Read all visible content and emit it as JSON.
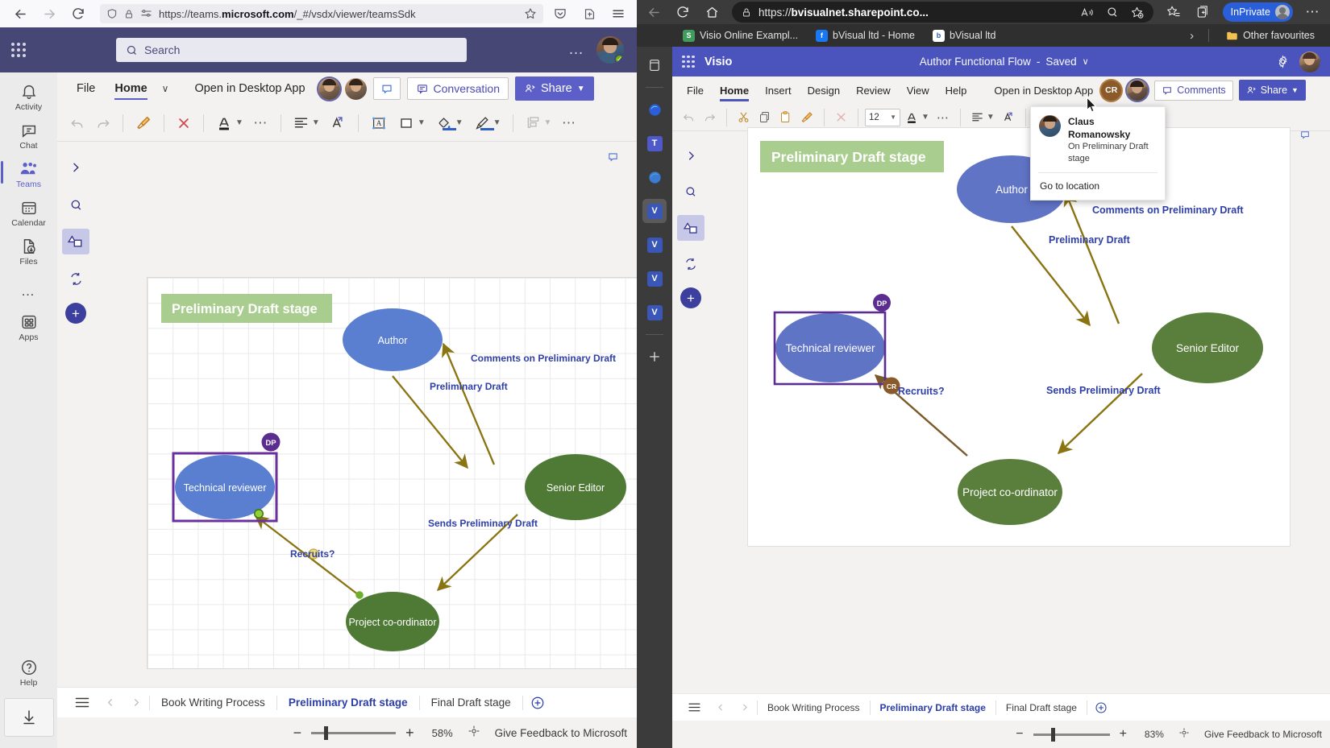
{
  "left_window": {
    "browser": {
      "name": "firefox",
      "url_prefix": "https://teams.",
      "url_domain": "microsoft.com",
      "url_suffix": "/_#/vsdx/viewer/teamsSdk",
      "icons": [
        "back-arrow-icon",
        "forward-arrow-icon",
        "reload-icon",
        "shield-icon",
        "lock-icon",
        "permissions-icon",
        "bookmark-star-icon",
        "pocket-icon",
        "extensions-icon",
        "hamburger-menu-icon"
      ]
    },
    "teams_bar": {
      "search_placeholder": "Search",
      "more_label": "…"
    },
    "rail": {
      "items": [
        {
          "label": "Activity",
          "icon": "bell-icon",
          "active": false
        },
        {
          "label": "Chat",
          "icon": "chat-icon",
          "active": false
        },
        {
          "label": "Teams",
          "icon": "people-icon",
          "active": true
        },
        {
          "label": "Calendar",
          "icon": "calendar-icon",
          "active": false
        },
        {
          "label": "Files",
          "icon": "files-download-icon",
          "active": false
        },
        {
          "label": "…",
          "icon": "more-dots-icon",
          "active": false
        },
        {
          "label": "Apps",
          "icon": "apps-grid-icon",
          "active": false
        }
      ],
      "help_label": "Help",
      "download_icon": "download-arrow-icon"
    },
    "ribbon": {
      "menu": [
        "File",
        "Home"
      ],
      "selected_menu": "Home",
      "chevron": "∨",
      "open_in_desktop": "Open in Desktop App",
      "conversation_label": "Conversation",
      "share_label": "Share",
      "comment_icon": "comment-bubble-icon",
      "tools": [
        "undo-icon",
        "redo-icon",
        "format-painter-icon",
        "delete-x-icon",
        "font-color-icon",
        "more-font-icon",
        "align-icon",
        "text-direction-icon",
        "text-box-icon",
        "shape-icon",
        "fill-color-icon",
        "line-color-icon",
        "arrange-icon",
        "overflow-dots-icon"
      ]
    },
    "shapes_rail": {
      "items": [
        "expand-chevron-icon",
        "search-shapes-icon",
        "shapes-icon",
        "replace-shape-icon",
        "add-shape-icon"
      ],
      "selected": "shapes-icon"
    },
    "sheet_bar": {
      "menu_icon": "hamburger-icon",
      "prev_icon": "chevron-left-icon",
      "next_icon": "chevron-right-icon",
      "tabs": [
        "Book Writing Process",
        "Preliminary Draft stage",
        "Final Draft stage"
      ],
      "active_tab": "Preliminary Draft stage",
      "add_icon": "plus-circle-icon"
    },
    "zoom_bar": {
      "minus": "−",
      "plus": "+",
      "zoom_level": "58%",
      "fit_icon": "fit-page-icon",
      "feedback_label": "Give Feedback to Microsoft"
    }
  },
  "right_window": {
    "browser": {
      "name": "edge",
      "url_prefix": "https://",
      "url_domain": "bvisualnet.sharepoint.co...",
      "inprivate_label": "InPrivate",
      "icons": [
        "back-arrow-icon",
        "reload-icon",
        "home-icon",
        "lock-icon",
        "read-aloud-icon",
        "find-icon",
        "add-favourite-icon",
        "favourites-icon",
        "collections-icon",
        "settings-dots-icon"
      ],
      "favourites": [
        {
          "label": "Visio Online Exampl...",
          "badge": "S",
          "color": "#3f9c5c"
        },
        {
          "label": "bVisual ltd - Home",
          "badge": "f",
          "color": "#1877f2"
        },
        {
          "label": "bVisual ltd",
          "badge": "b",
          "color": "#ffffff"
        }
      ],
      "favourites_overflow": "›",
      "other_favourites": "Other favourites",
      "folder_icon": "folder-icon"
    },
    "tab_rail": {
      "icons": [
        "vertical-tabs-icon",
        "edge-copilot-icon",
        "teams-icon",
        "edge-icon",
        "visio-icon",
        "visio-icon",
        "visio-icon",
        "visio-icon",
        "new-tab-plus-icon"
      ],
      "selected_index": 4
    },
    "app_bar": {
      "app_name": "Visio",
      "doc_title": "Author Functional Flow",
      "doc_status": "Saved",
      "doc_separator": "-",
      "chevron": "∨",
      "settings_icon": "gear-icon",
      "avatar_icon": "user-avatar"
    },
    "ribbon": {
      "menu": [
        "File",
        "Home",
        "Insert",
        "Design",
        "Review",
        "View",
        "Help"
      ],
      "selected_menu": "Home",
      "open_in_desktop": "Open in Desktop App",
      "comments_label": "Comments",
      "share_label": "Share",
      "collab_initials": "CR",
      "font_size": "12",
      "tools": [
        "undo-icon",
        "redo-icon",
        "cut-scissors-icon",
        "copy-icon",
        "paste-icon",
        "format-painter-icon",
        "delete-x-icon",
        "font-color-icon",
        "more-font-icon",
        "align-icon",
        "text-direction-icon",
        "text-box-icon",
        "overflow-dots-icon"
      ]
    },
    "shapes_rail": {
      "items": [
        "expand-chevron-icon",
        "search-shapes-icon",
        "shapes-icon",
        "replace-shape-icon",
        "add-shape-icon"
      ],
      "selected": "shapes-icon"
    },
    "sheet_bar": {
      "tabs": [
        "Book Writing Process",
        "Preliminary Draft stage",
        "Final Draft stage"
      ],
      "active_tab": "Preliminary Draft stage"
    },
    "zoom_bar": {
      "minus": "−",
      "plus": "+",
      "zoom_level": "83%",
      "fit_icon": "fit-page-icon",
      "feedback_label": "Give Feedback to Microsoft"
    },
    "callout": {
      "name": "Claus Romanowsky",
      "subtitle": "On Preliminary Draft stage",
      "action": "Go to location"
    }
  },
  "chart_data": {
    "type": "diagram",
    "title": "Preliminary Draft stage",
    "diagram_kind": "visio-functional-flow",
    "banner": {
      "text": "Preliminary Draft stage",
      "fill": "#a9cd8e",
      "text_color": "#ffffff"
    },
    "nodes": [
      {
        "id": "author",
        "label": "Author",
        "shape": "ellipse",
        "fill": "#5a7fd0",
        "text_color": "#ffffff"
      },
      {
        "id": "senior",
        "label": "Senior Editor",
        "shape": "ellipse",
        "fill": "#4f7a35",
        "text_color": "#ffffff"
      },
      {
        "id": "tech",
        "label": "Technical reviewer",
        "shape": "ellipse",
        "fill": "#5a7fd0",
        "text_color": "#ffffff",
        "selected": true,
        "badge": "DP",
        "badge_color": "#5b2d91"
      },
      {
        "id": "coord",
        "label": "Project co-ordinator",
        "shape": "ellipse",
        "fill": "#4f7a35",
        "text_color": "#ffffff"
      }
    ],
    "edges": [
      {
        "from": "author",
        "to": "senior",
        "label": "Preliminary Draft"
      },
      {
        "from": "senior",
        "to": "author",
        "label": "Comments on Preliminary Draft"
      },
      {
        "from": "senior",
        "to": "coord",
        "label": "Sends Preliminary Draft"
      },
      {
        "from": "coord",
        "to": "tech",
        "label": "Recruits?"
      }
    ],
    "edge_color": "#8a7411",
    "label_color": "#2f3fa8",
    "selection_color": "#6b2fa0",
    "left_badge": {
      "initials": "DP",
      "color": "#5b2d91"
    },
    "right_badge": {
      "initials": "CR",
      "color": "#8a5a2b"
    }
  }
}
